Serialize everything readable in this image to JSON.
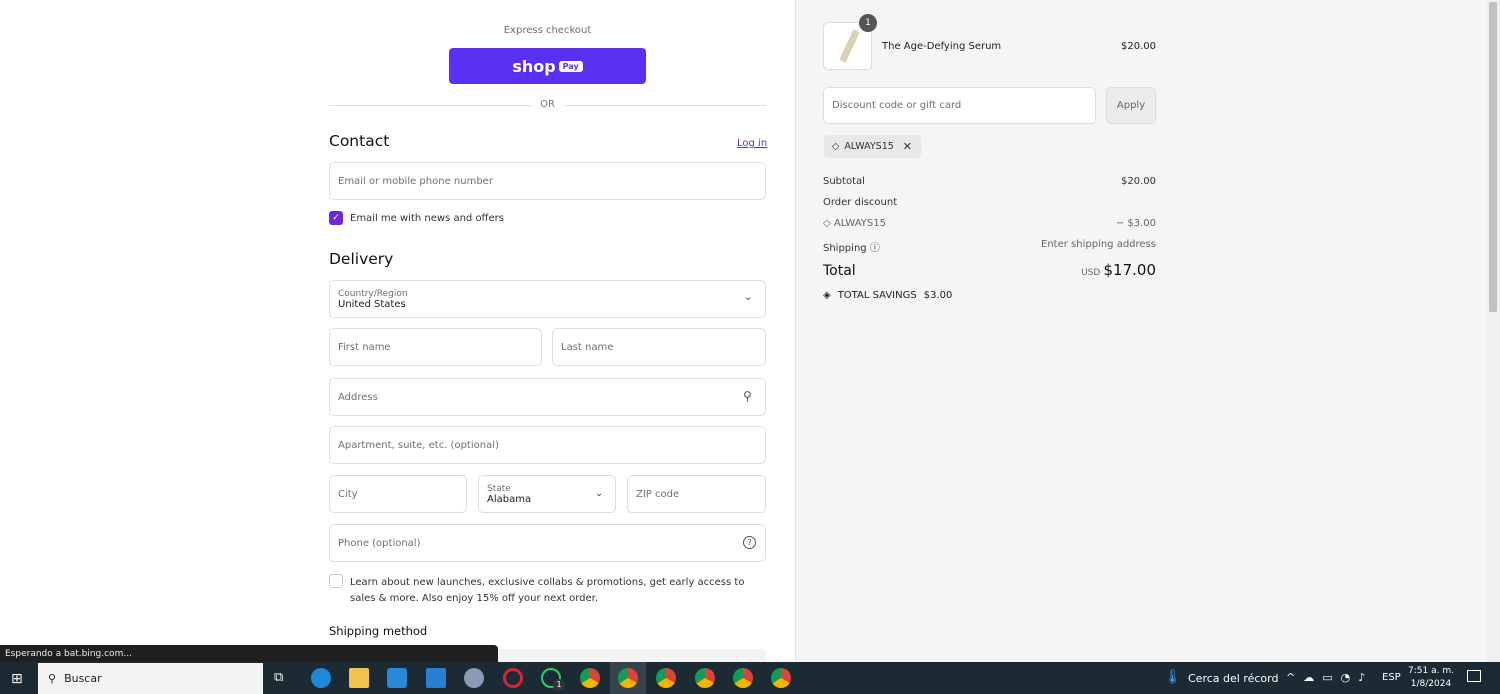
{
  "express": {
    "label": "Express checkout",
    "shop_pay": "shop",
    "pay_badge": "Pay",
    "or": "OR"
  },
  "contact": {
    "title": "Contact",
    "login": "Log in",
    "email_placeholder": "Email or mobile phone number",
    "newsletter_label": "Email me with news and offers",
    "newsletter_checked": true
  },
  "delivery": {
    "title": "Delivery",
    "country_label": "Country/Region",
    "country_value": "United States",
    "first_name": "First name",
    "last_name": "Last name",
    "address": "Address",
    "apartment": "Apartment, suite, etc. (optional)",
    "city": "City",
    "state_label": "State",
    "state_value": "Alabama",
    "zip": "ZIP code",
    "phone": "Phone (optional)",
    "marketing_text": "Learn about new launches, exclusive collabs & promotions, get early access to sales & more. Also enjoy 15% off your next order.",
    "shipping_method": "Shipping method"
  },
  "summary": {
    "item": {
      "name": "The Age-Defying Serum",
      "price": "$20.00",
      "qty": "1"
    },
    "discount_placeholder": "Discount code or gift card",
    "apply": "Apply",
    "applied_code": "ALWAYS15",
    "subtotal_label": "Subtotal",
    "subtotal": "$20.00",
    "order_discount_label": "Order discount",
    "discount_code": "ALWAYS15",
    "discount_amount": "− $3.00",
    "shipping_label": "Shipping",
    "shipping_value": "Enter shipping address",
    "total_label": "Total",
    "currency": "USD",
    "total": "$17.00",
    "savings_label": "TOTAL SAVINGS",
    "savings": "$3.00"
  },
  "status_bar": "Esperando a bat.bing.com...",
  "taskbar": {
    "search": "Buscar",
    "weather": "Cerca del récord",
    "language": "ESP",
    "time": "7:51 a. m.",
    "date": "1/8/2024",
    "whatsapp_badge": "1"
  },
  "colors": {
    "accent": "#5a31f4",
    "checkbox": "#6d28d9",
    "link": "#6d28d9"
  }
}
